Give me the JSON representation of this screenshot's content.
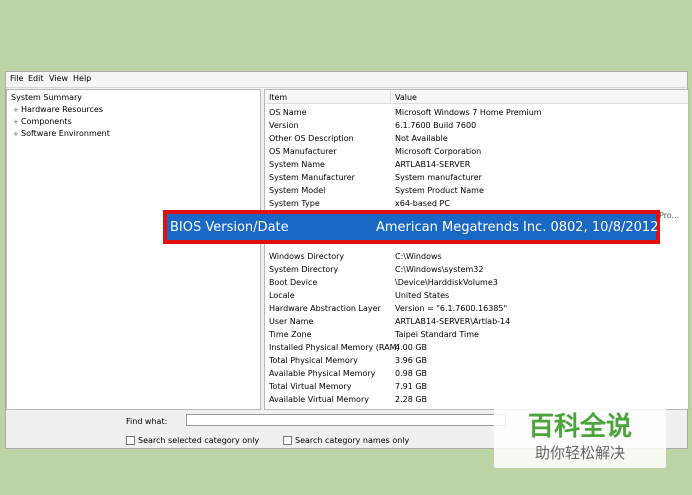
{
  "menu": [
    "File",
    "Edit",
    "View",
    "Help"
  ],
  "tree": [
    {
      "label": "System Summary",
      "expander": ""
    },
    {
      "label": "Hardware Resources",
      "expander": "+"
    },
    {
      "label": "Components",
      "expander": "+"
    },
    {
      "label": "Software Environment",
      "expander": "+"
    }
  ],
  "table": {
    "headers": [
      "Item",
      "Value"
    ],
    "rows": [
      [
        "OS Name",
        "Microsoft Windows 7 Home Premium"
      ],
      [
        "Version",
        "6.1.7600 Build 7600"
      ],
      [
        "Other OS Description",
        "Not Available"
      ],
      [
        "OS Manufacturer",
        "Microsoft Corporation"
      ],
      [
        "System Name",
        "ARTLAB14-SERVER"
      ],
      [
        "System Manufacturer",
        "System manufacturer"
      ],
      [
        "System Model",
        "System Product Name"
      ],
      [
        "System Type",
        "x64-based PC"
      ],
      [
        "Windows Directory",
        "C:\\Windows"
      ],
      [
        "System Directory",
        "C:\\Windows\\system32"
      ],
      [
        "Boot Device",
        "\\Device\\HarddiskVolume3"
      ],
      [
        "Locale",
        "United States"
      ],
      [
        "Hardware Abstraction Layer",
        "Version = \"6.1.7600.16385\""
      ],
      [
        "User Name",
        "ARTLAB14-SERVER\\Artlab-14"
      ],
      [
        "Time Zone",
        "Taipei Standard Time"
      ],
      [
        "Installed Physical Memory (RAM)",
        "4.00 GB"
      ],
      [
        "Total Physical Memory",
        "3.96 GB"
      ],
      [
        "Available Physical Memory",
        "0.98 GB"
      ],
      [
        "Total Virtual Memory",
        "7.91 GB"
      ],
      [
        "Available Virtual Memory",
        "2.28 GB"
      ]
    ],
    "processor_overflow": "Pro..."
  },
  "highlight": {
    "item": "BIOS Version/Date",
    "value": "American Megatrends Inc. 0802, 10/8/2012"
  },
  "find": {
    "label": "Find what:",
    "option1": "Search selected category only",
    "option2": "Search category names only"
  },
  "watermark": {
    "title": "百科全说",
    "subtitle": "助你轻松解决"
  }
}
